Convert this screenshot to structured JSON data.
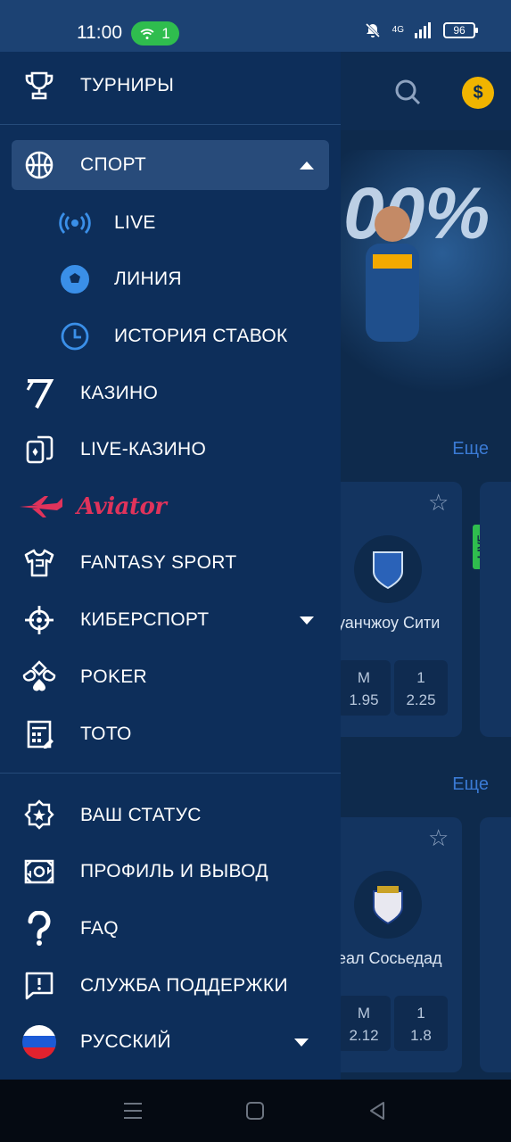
{
  "status_bar": {
    "time": "11:00",
    "hotspot_count": "1",
    "network": "4G",
    "battery": "96"
  },
  "background": {
    "banner_text": "00%",
    "more_label_1": "Еще",
    "more_label_2": "Еще",
    "live_badge": "LIVE",
    "cards": [
      {
        "team": "уанчжоу Сити",
        "odds": [
          {
            "label": "М",
            "value": "1.95"
          },
          {
            "label": "1",
            "value": "2.25"
          }
        ]
      },
      {
        "team": "еал Сосьедад",
        "odds": [
          {
            "label": "М",
            "value": "2.12"
          },
          {
            "label": "1",
            "value": "1.8"
          }
        ]
      }
    ]
  },
  "drawer": {
    "tournaments": "ТУРНИРЫ",
    "sport": "СПОРТ",
    "live": "LIVE",
    "line": "ЛИНИЯ",
    "bet_history": "ИСТОРИЯ СТАВОК",
    "casino": "КАЗИНО",
    "live_casino": "LIVE-КАЗИНО",
    "aviator": "Aviator",
    "fantasy_sport": "FANTASY SPORT",
    "esports": "КИБЕРСПОРТ",
    "poker": "POKER",
    "toto": "ТОТО",
    "your_status": "ВАШ СТАТУС",
    "profile_withdraw": "ПРОФИЛЬ И ВЫВОД",
    "faq": "FAQ",
    "support": "СЛУЖБА ПОДДЕРЖКИ",
    "language": "РУССКИЙ"
  },
  "colors": {
    "drawer_bg": "#0d2e5a",
    "active_bg": "#284b7a",
    "accent_blue": "#3a8fe8",
    "aviator_red": "#e0335b",
    "live_green": "#2fbd4e"
  }
}
